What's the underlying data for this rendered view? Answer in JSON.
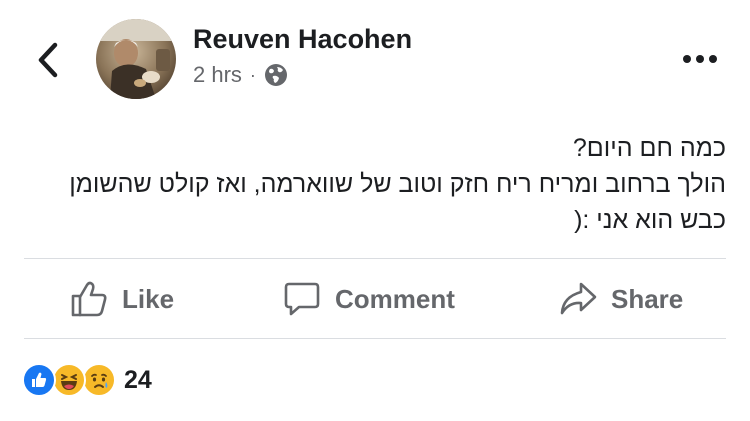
{
  "post": {
    "author_name": "Reuven Hacohen",
    "timestamp": "2 hrs",
    "separator": "·",
    "audience_icon": "globe-icon",
    "text_lines": [
      "כמה חם היום?",
      "הולך ברחוב ומריח ריח חזק וטוב של שווארמה, ואז קולט שהשומן",
      "כבש הוא אני :("
    ]
  },
  "header": {
    "back_icon": "chevron-left-icon",
    "more_icon": "more-horizontal-icon"
  },
  "actions": {
    "like_label": "Like",
    "comment_label": "Comment",
    "share_label": "Share"
  },
  "reactions": {
    "icons": [
      "like-reaction-icon",
      "haha-reaction-icon",
      "sad-reaction-icon"
    ],
    "count": "24"
  },
  "colors": {
    "text_primary": "#1c1e21",
    "text_secondary": "#65676b",
    "divider": "#dadde1",
    "like_blue": "#1877f2",
    "reaction_yellow": "#f7b928"
  }
}
